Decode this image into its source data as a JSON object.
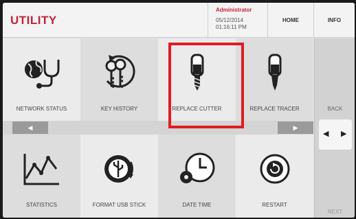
{
  "header": {
    "title": "UTILITY",
    "user": "Administrator",
    "date": "05/12/2014",
    "time": "01:16:11 PM",
    "home_label": "HOME",
    "info_label": "INFO"
  },
  "tiles": [
    {
      "label": "NETWORK STATUS",
      "icon": "network-stethoscope-icon"
    },
    {
      "label": "KEY HISTORY",
      "icon": "key-history-icon"
    },
    {
      "label": "REPLACE CUTTER",
      "icon": "cutter-icon"
    },
    {
      "label": "REPLACE TRACER",
      "icon": "tracer-icon"
    },
    {
      "label": "STATISTICS",
      "icon": "line-chart-icon"
    },
    {
      "label": "FORMAT USB STICK",
      "icon": "usb-icon"
    },
    {
      "label": "DATE TIME",
      "icon": "clock-gear-icon"
    },
    {
      "label": "RESTART",
      "icon": "restart-icon"
    }
  ],
  "selected_tile": "REPLACE CUTTER",
  "nav": {
    "prev_icon": "arrow-left-icon",
    "next_icon": "arrow-right-icon"
  },
  "side": {
    "back_label": "BACK",
    "next_label": "NEXT"
  },
  "colors": {
    "accent": "#c0233b",
    "highlight": "#e11b22"
  }
}
